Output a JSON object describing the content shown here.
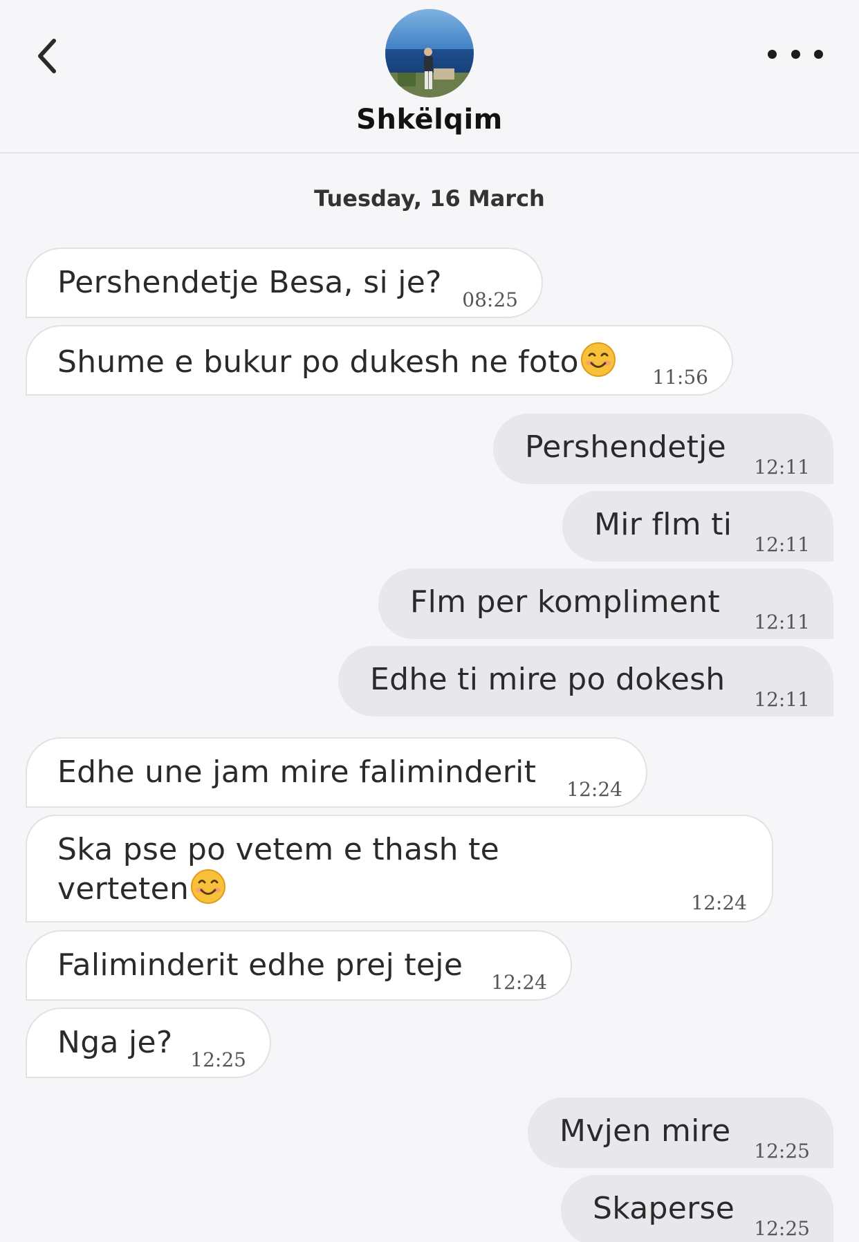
{
  "header": {
    "contact_name": "Shkëlqim",
    "back_icon": "chevron-left-icon",
    "more_icon": "more-horizontal-icon"
  },
  "date_separator": "Tuesday, 16 March",
  "messages": [
    {
      "dir": "in",
      "text": "Pershendetje Besa, si je?",
      "time": "08:25"
    },
    {
      "dir": "in",
      "text": "Shume e bukur po dukesh ne foto",
      "emoji": "smiling-face-emoji",
      "time": "11:56"
    },
    {
      "dir": "out",
      "text": "Pershendetje",
      "time": "12:11"
    },
    {
      "dir": "out",
      "text": "Mir flm ti",
      "time": "12:11"
    },
    {
      "dir": "out",
      "text": "Flm per kompliment",
      "time": "12:11"
    },
    {
      "dir": "out",
      "text": "Edhe ti mire po dokesh",
      "time": "12:11"
    },
    {
      "dir": "in",
      "text": "Edhe une jam mire faliminderit",
      "time": "12:24"
    },
    {
      "dir": "in",
      "text": "Ska pse po vetem e thash te verteten",
      "emoji": "smiling-face-emoji",
      "time": "12:24"
    },
    {
      "dir": "in",
      "text": "Faliminderit edhe prej teje",
      "time": "12:24"
    },
    {
      "dir": "in",
      "text": "Nga je?",
      "time": "12:25"
    },
    {
      "dir": "out",
      "text": "Mvjen mire",
      "time": "12:25"
    },
    {
      "dir": "out",
      "text": "Skaperse",
      "time": "12:25"
    }
  ]
}
